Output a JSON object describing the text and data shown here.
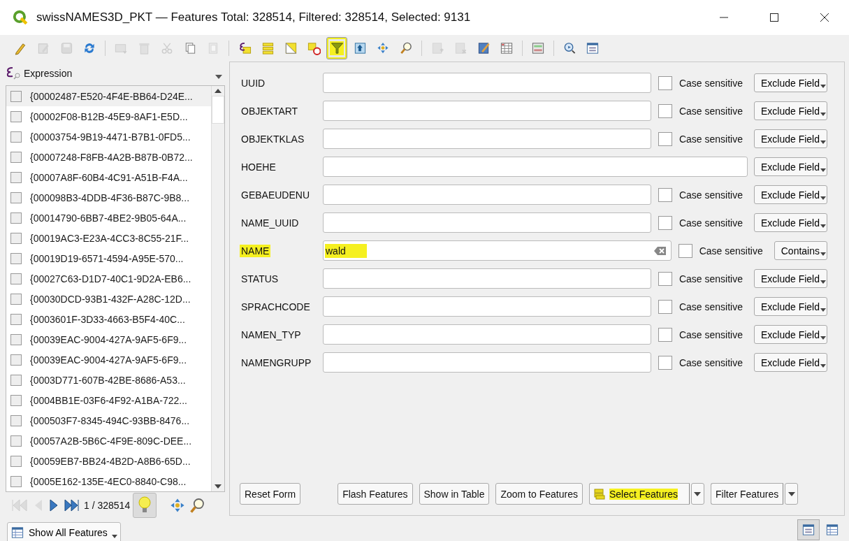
{
  "window": {
    "title": "swissNAMES3D_PKT — Features Total: 328514, Filtered: 328514, Selected: 9131"
  },
  "toolbar": [
    {
      "kind": "pencil",
      "disabled": false,
      "on": false
    },
    {
      "kind": "multi-edit",
      "disabled": true,
      "on": false
    },
    {
      "kind": "save",
      "disabled": true,
      "on": false
    },
    {
      "kind": "reload",
      "disabled": false,
      "on": false
    },
    {
      "kind": "separator"
    },
    {
      "kind": "add-feature",
      "disabled": true,
      "on": false
    },
    {
      "kind": "delete",
      "disabled": true,
      "on": false
    },
    {
      "kind": "cut",
      "disabled": true,
      "on": false
    },
    {
      "kind": "copy",
      "disabled": false,
      "on": false
    },
    {
      "kind": "paste",
      "disabled": true,
      "on": false
    },
    {
      "kind": "separator"
    },
    {
      "kind": "expression-select",
      "disabled": false,
      "on": false
    },
    {
      "kind": "select-all",
      "disabled": false,
      "on": false
    },
    {
      "kind": "invert",
      "disabled": false,
      "on": false
    },
    {
      "kind": "deselect",
      "disabled": false,
      "on": false
    },
    {
      "kind": "filter",
      "disabled": false,
      "on": true
    },
    {
      "kind": "move-top",
      "disabled": false,
      "on": false
    },
    {
      "kind": "pan",
      "disabled": false,
      "on": false
    },
    {
      "kind": "zoom",
      "disabled": false,
      "on": false
    },
    {
      "kind": "separator"
    },
    {
      "kind": "new-field",
      "disabled": true,
      "on": false
    },
    {
      "kind": "delete-field",
      "disabled": true,
      "on": false
    },
    {
      "kind": "field-calc",
      "disabled": false,
      "on": false
    },
    {
      "kind": "format",
      "disabled": false,
      "on": false
    },
    {
      "kind": "separator"
    },
    {
      "kind": "dock",
      "disabled": false,
      "on": false
    },
    {
      "kind": "separator"
    },
    {
      "kind": "actions",
      "disabled": false,
      "on": false
    },
    {
      "kind": "form",
      "disabled": false,
      "on": false
    }
  ],
  "expression_header": "Expression",
  "features": [
    {
      "label": "{00002487-E520-4F4E-BB64-D24E...",
      "checked": false,
      "selected": true
    },
    {
      "label": "{00002F08-B12B-45E9-8AF1-E5D...",
      "checked": false,
      "selected": false
    },
    {
      "label": "{00003754-9B19-4471-B7B1-0FD5...",
      "checked": false,
      "selected": false
    },
    {
      "label": "{00007248-F8FB-4A2B-B87B-0B72...",
      "checked": false,
      "selected": false
    },
    {
      "label": "{00007A8F-60B4-4C91-A51B-F4A...",
      "checked": false,
      "selected": false
    },
    {
      "label": "{000098B3-4DDB-4F36-B87C-9B8...",
      "checked": false,
      "selected": false
    },
    {
      "label": "{00014790-6BB7-4BE2-9B05-64A...",
      "checked": false,
      "selected": false
    },
    {
      "label": "{00019AC3-E23A-4CC3-8C55-21F...",
      "checked": false,
      "selected": false
    },
    {
      "label": "{00019D19-6571-4594-A95E-570...",
      "checked": false,
      "selected": false
    },
    {
      "label": "{00027C63-D1D7-40C1-9D2A-EB6...",
      "checked": false,
      "selected": false
    },
    {
      "label": "{00030DCD-93B1-432F-A28C-12D...",
      "checked": false,
      "selected": false
    },
    {
      "label": "{0003601F-3D33-4663-B5F4-40C...",
      "checked": false,
      "selected": false
    },
    {
      "label": "{00039EAC-9004-427A-9AF5-6F9...",
      "checked": false,
      "selected": false
    },
    {
      "label": "{00039EAC-9004-427A-9AF5-6F9...",
      "checked": false,
      "selected": false
    },
    {
      "label": "{0003D771-607B-42BE-8686-A53...",
      "checked": false,
      "selected": false
    },
    {
      "label": "{0004BB1E-03F6-4F92-A1BA-722...",
      "checked": false,
      "selected": false
    },
    {
      "label": "{000503F7-8345-494C-93BB-8476...",
      "checked": false,
      "selected": false
    },
    {
      "label": "{00057A2B-5B6C-4F9E-809C-DEE...",
      "checked": false,
      "selected": false
    },
    {
      "label": "{00059EB7-BB24-4B2D-A8B6-65D...",
      "checked": false,
      "selected": false
    },
    {
      "label": "{0005E162-135E-4EC0-8840-C98...",
      "checked": false,
      "selected": false
    }
  ],
  "navigator": {
    "position": "1 / 328514",
    "highlight_on": true
  },
  "show_features": "Show All Features",
  "form_fields": [
    {
      "label": "UUID",
      "case_sensitive": {
        "shown": true,
        "label": "Case sensitive",
        "checked": false
      },
      "mode": "Exclude Field",
      "highlighted": false,
      "clear_button": false
    },
    {
      "label": "OBJEKTART",
      "case_sensitive": {
        "shown": true,
        "label": "Case sensitive",
        "checked": false
      },
      "mode": "Exclude Field",
      "highlighted": false,
      "clear_button": false
    },
    {
      "label": "OBJEKTKLAS",
      "case_sensitive": {
        "shown": true,
        "label": "Case sensitive",
        "checked": false
      },
      "mode": "Exclude Field",
      "highlighted": false,
      "clear_button": false
    },
    {
      "label": "HOEHE",
      "case_sensitive": {
        "shown": false
      },
      "mode": "Exclude Field",
      "highlighted": false,
      "clear_button": false
    },
    {
      "label": "GEBAEUDENU",
      "case_sensitive": {
        "shown": true,
        "label": "Case sensitive",
        "checked": false
      },
      "mode": "Exclude Field",
      "highlighted": false,
      "clear_button": false
    },
    {
      "label": "NAME_UUID",
      "case_sensitive": {
        "shown": true,
        "label": "Case sensitive",
        "checked": false
      },
      "mode": "Exclude Field",
      "highlighted": false,
      "clear_button": false
    },
    {
      "label": "NAME",
      "value": "wald",
      "case_sensitive": {
        "shown": true,
        "label": "Case sensitive",
        "checked": false
      },
      "mode": "Contains",
      "highlighted": true,
      "clear_button": true
    },
    {
      "label": "STATUS",
      "case_sensitive": {
        "shown": true,
        "label": "Case sensitive",
        "checked": false
      },
      "mode": "Exclude Field",
      "highlighted": false,
      "clear_button": false
    },
    {
      "label": "SPRACHCODE",
      "case_sensitive": {
        "shown": true,
        "label": "Case sensitive",
        "checked": false
      },
      "mode": "Exclude Field",
      "highlighted": false,
      "clear_button": false
    },
    {
      "label": "NAMEN_TYP",
      "case_sensitive": {
        "shown": true,
        "label": "Case sensitive",
        "checked": false
      },
      "mode": "Exclude Field",
      "highlighted": false,
      "clear_button": false
    },
    {
      "label": "NAMENGRUPP",
      "case_sensitive": {
        "shown": true,
        "label": "Case sensitive",
        "checked": false
      },
      "mode": "Exclude Field",
      "highlighted": false,
      "clear_button": false
    }
  ],
  "actions": [
    {
      "label": "Reset Form",
      "kind": "reset",
      "highlighted": false,
      "menu": false
    },
    {
      "label": "Flash Features",
      "kind": "plain",
      "highlighted": false,
      "menu": false
    },
    {
      "label": "Show in Table",
      "kind": "plain",
      "highlighted": false,
      "menu": false
    },
    {
      "label": "Zoom to Features",
      "kind": "plain",
      "highlighted": false,
      "menu": false
    },
    {
      "label": "Select Features",
      "kind": "select",
      "highlighted": true,
      "menu": true
    },
    {
      "label": "Filter Features",
      "kind": "plain",
      "highlighted": false,
      "menu": true
    }
  ],
  "view_modes": [
    {
      "kind": "form",
      "selected": true
    },
    {
      "kind": "table",
      "selected": false
    }
  ]
}
